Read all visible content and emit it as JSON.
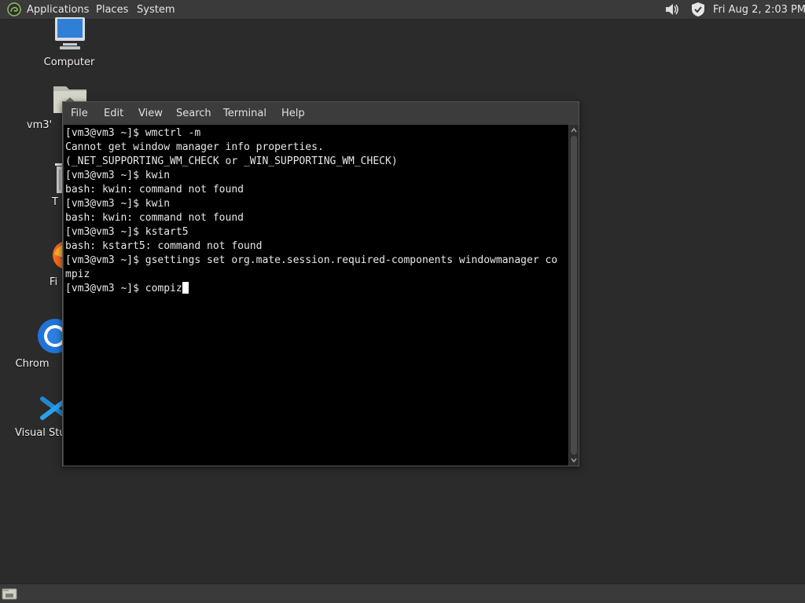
{
  "top_panel": {
    "menus": [
      "Applications",
      "Places",
      "System"
    ],
    "clock": "Fri Aug  2,  2:03 PM",
    "icons": [
      "mate-logo-icon",
      "volume-icon",
      "shield-update-icon"
    ]
  },
  "desktop": {
    "icons": [
      {
        "label": "Computer",
        "icon": "computer-icon"
      },
      {
        "label": "vm3'",
        "icon": "home-folder-icon"
      },
      {
        "label": "T",
        "icon": "trash-icon"
      },
      {
        "label": "Fi",
        "icon": "firefox-icon"
      },
      {
        "label": "Chrom",
        "icon": "chromium-icon"
      },
      {
        "label": "Visual Stud",
        "icon": "vscode-icon"
      }
    ]
  },
  "terminal": {
    "menus": [
      "File",
      "Edit",
      "View",
      "Search",
      "Terminal",
      "Help"
    ],
    "lines": [
      "[vm3@vm3 ~]$ wmctrl -m",
      "Cannot get window manager info properties.",
      "(_NET_SUPPORTING_WM_CHECK or _WIN_SUPPORTING_WM_CHECK)",
      "[vm3@vm3 ~]$ kwin",
      "bash: kwin: command not found",
      "[vm3@vm3 ~]$ kwin",
      "bash: kwin: command not found",
      "[vm3@vm3 ~]$ kstart5",
      "bash: kstart5: command not found",
      "[vm3@vm3 ~]$ gsettings set org.mate.session.required-components windowmanager co",
      "mpiz"
    ],
    "current_line": "[vm3@vm3 ~]$ compiz"
  },
  "colors": {
    "panel_bg": "#3a3a3a",
    "desktop_bg": "#2b2b2b",
    "terminal_bg": "#000000",
    "terminal_fg": "#e8e8e8"
  }
}
